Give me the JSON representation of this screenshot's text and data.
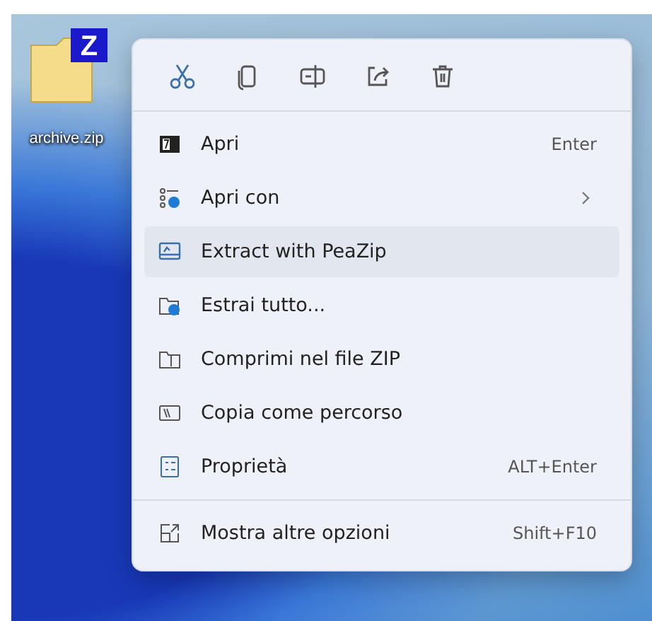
{
  "desktop_icon": {
    "label": "archive.zip",
    "badge": "Z"
  },
  "menu": {
    "sections": [
      {
        "items": [
          {
            "label": "Apri",
            "shortcut": "Enter",
            "submenu": false,
            "selected": false
          },
          {
            "label": "Apri con",
            "submenu": true,
            "selected": false
          },
          {
            "label": "Extract with PeaZip",
            "submenu": false,
            "selected": true
          },
          {
            "label": "Estrai tutto...",
            "submenu": false,
            "selected": false
          },
          {
            "label": "Comprimi nel file ZIP",
            "submenu": false,
            "selected": false
          },
          {
            "label": "Copia come percorso",
            "submenu": false,
            "selected": false
          },
          {
            "label": "Proprietà",
            "shortcut": "ALT+Enter",
            "submenu": false,
            "selected": false
          }
        ]
      },
      {
        "items": [
          {
            "label": "Mostra altre opzioni",
            "shortcut": "Shift+F10",
            "submenu": false,
            "selected": false
          }
        ]
      }
    ]
  }
}
